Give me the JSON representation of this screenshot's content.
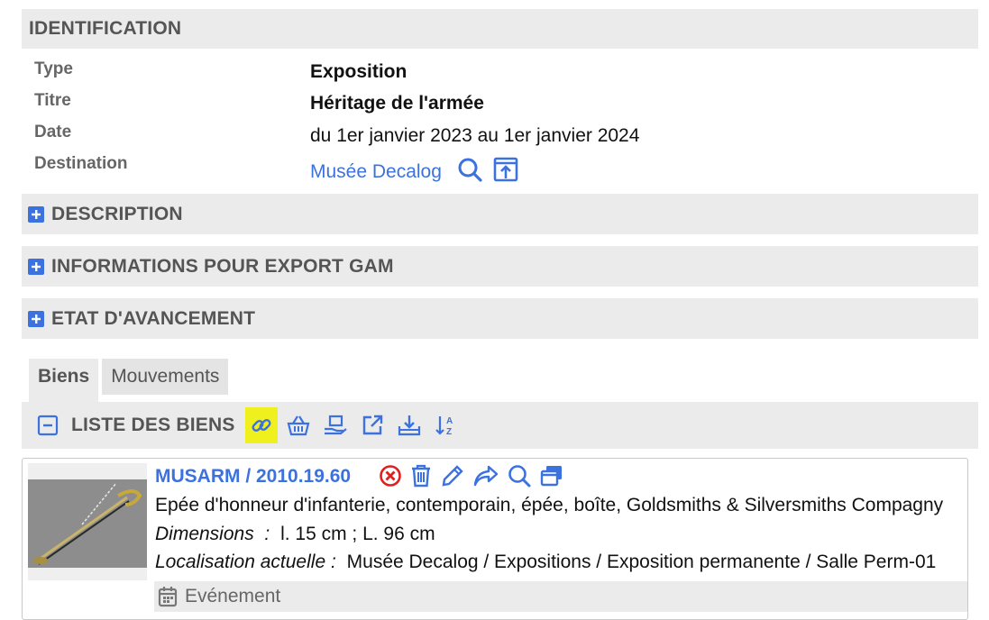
{
  "identification": {
    "title": "IDENTIFICATION",
    "fields": [
      {
        "label": "Type",
        "value": "Exposition"
      },
      {
        "label": "Titre",
        "value": "Héritage de l'armée"
      },
      {
        "label": "Date",
        "value": "du 1er janvier 2023 au 1er janvier 2024"
      },
      {
        "label": "Destination",
        "value": "Musée Decalog"
      }
    ]
  },
  "sections": [
    {
      "title": "DESCRIPTION"
    },
    {
      "title": "INFORMATIONS POUR EXPORT GAM"
    },
    {
      "title": "ETAT D'AVANCEMENT"
    }
  ],
  "tabs": [
    {
      "label": "Biens",
      "active": true
    },
    {
      "label": "Mouvements",
      "active": false
    }
  ],
  "list": {
    "title": "LISTE DES BIENS",
    "toolbar_icons": [
      "link-icon",
      "basket-icon",
      "hand-box-icon",
      "external-link-icon",
      "download-tray-icon",
      "sort-az-icon"
    ]
  },
  "item": {
    "title": "MUSARM / 2010.19.60",
    "description": "Epée d'honneur d'infanterie, contemporain, épée, boîte, Goldsmiths & Silversmiths Compagny",
    "dimensions_label": "Dimensions  :",
    "dimensions_value": "l. 15 cm ; L. 96 cm",
    "location_label": "Localisation actuelle :",
    "location_value": "Musée Decalog / Expositions / Exposition permanente / Salle Perm-01",
    "event_label": "Evénement"
  },
  "colors": {
    "accent": "#3b72e0",
    "danger": "#e02020",
    "highlight": "#f0f01e",
    "bar": "#ebebeb"
  }
}
